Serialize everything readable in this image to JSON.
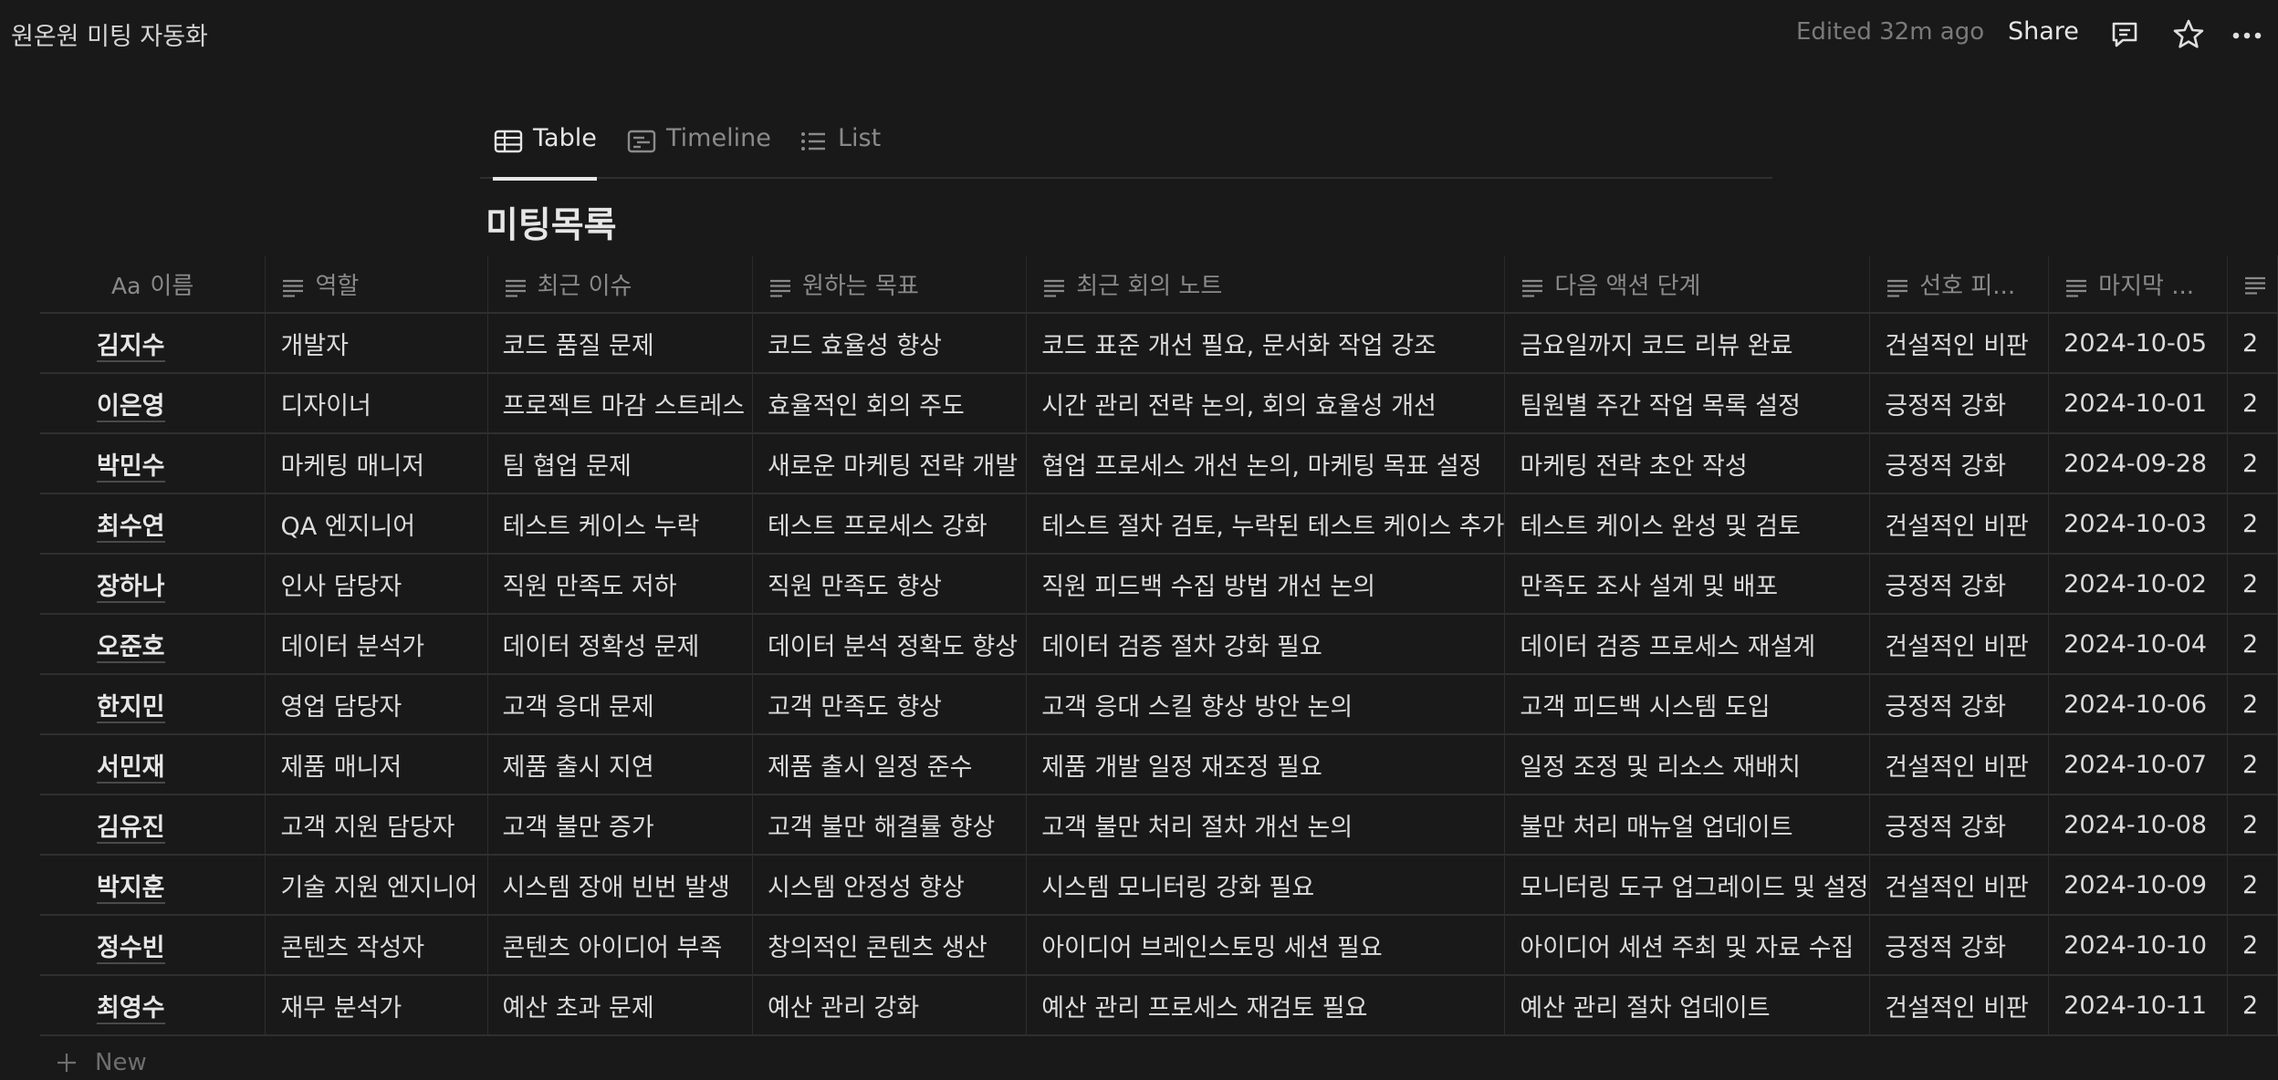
{
  "topbar": {
    "title": "원온원 미팅 자동화",
    "edited": "Edited 32m ago",
    "share_label": "Share"
  },
  "icons": {
    "comment": "comment-icon",
    "star": "star-icon",
    "more": "more-icon",
    "table": "table-icon",
    "timeline": "timeline-icon",
    "list": "list-icon",
    "text_property": "text-lines-icon",
    "plus": "plus-icon"
  },
  "tabs": [
    {
      "label": "Table",
      "active": true
    },
    {
      "label": "Timeline",
      "active": false
    },
    {
      "label": "List",
      "active": false
    }
  ],
  "database": {
    "title": "미팅목록",
    "name_prefix": "Aa",
    "columns": [
      "이름",
      "역할",
      "최근 이슈",
      "원하는 목표",
      "최근 회의 노트",
      "다음 액션 단계",
      "선호 피...",
      "마지막 ...",
      ""
    ],
    "rows": [
      [
        "김지수",
        "개발자",
        "코드 품질 문제",
        "코드 효율성 향상",
        "코드 표준 개선 필요, 문서화 작업 강조",
        "금요일까지 코드 리뷰 완료",
        "건설적인 비판",
        "2024-10-05",
        "2"
      ],
      [
        "이은영",
        "디자이너",
        "프로젝트 마감 스트레스",
        "효율적인 회의 주도",
        "시간 관리 전략 논의, 회의 효율성 개선",
        "팀원별 주간 작업 목록 설정",
        "긍정적 강화",
        "2024-10-01",
        "2"
      ],
      [
        "박민수",
        "마케팅 매니저",
        "팀 협업 문제",
        "새로운 마케팅 전략 개발",
        "협업 프로세스 개선 논의, 마케팅 목표 설정",
        "마케팅 전략 초안 작성",
        "긍정적 강화",
        "2024-09-28",
        "2"
      ],
      [
        "최수연",
        "QA 엔지니어",
        "테스트 케이스 누락",
        "테스트 프로세스 강화",
        "테스트 절차 검토, 누락된 테스트 케이스 추가",
        "테스트 케이스 완성 및 검토",
        "건설적인 비판",
        "2024-10-03",
        "2"
      ],
      [
        "장하나",
        "인사 담당자",
        "직원 만족도 저하",
        "직원 만족도 향상",
        "직원 피드백 수집 방법 개선 논의",
        "만족도 조사 설계 및 배포",
        "긍정적 강화",
        "2024-10-02",
        "2"
      ],
      [
        "오준호",
        "데이터 분석가",
        "데이터 정확성 문제",
        "데이터 분석 정확도 향상",
        "데이터 검증 절차 강화 필요",
        "데이터 검증 프로세스 재설계",
        "건설적인 비판",
        "2024-10-04",
        "2"
      ],
      [
        "한지민",
        "영업 담당자",
        "고객 응대 문제",
        "고객 만족도 향상",
        "고객 응대 스킬 향상 방안 논의",
        "고객 피드백 시스템 도입",
        "긍정적 강화",
        "2024-10-06",
        "2"
      ],
      [
        "서민재",
        "제품 매니저",
        "제품 출시 지연",
        "제품 출시 일정 준수",
        "제품 개발 일정 재조정 필요",
        "일정 조정 및 리소스 재배치",
        "건설적인 비판",
        "2024-10-07",
        "2"
      ],
      [
        "김유진",
        "고객 지원 담당자",
        "고객 불만 증가",
        "고객 불만 해결률 향상",
        "고객 불만 처리 절차 개선 논의",
        "불만 처리 매뉴얼 업데이트",
        "긍정적 강화",
        "2024-10-08",
        "2"
      ],
      [
        "박지훈",
        "기술 지원 엔지니어",
        "시스템 장애 빈번 발생",
        "시스템 안정성 향상",
        "시스템 모니터링 강화 필요",
        "모니터링 도구 업그레이드 및 설정",
        "건설적인 비판",
        "2024-10-09",
        "2"
      ],
      [
        "정수빈",
        "콘텐츠 작성자",
        "콘텐츠 아이디어 부족",
        "창의적인 콘텐츠 생산",
        "아이디어 브레인스토밍 세션 필요",
        "아이디어 세션 주최 및 자료 수집",
        "긍정적 강화",
        "2024-10-10",
        "2"
      ],
      [
        "최영수",
        "재무 분석가",
        "예산 초과 문제",
        "예산 관리 강화",
        "예산 관리 프로세스 재검토 필요",
        "예산 관리 절차 업데이트",
        "건설적인 비판",
        "2024-10-11",
        "2"
      ]
    ],
    "new_label": "New"
  }
}
